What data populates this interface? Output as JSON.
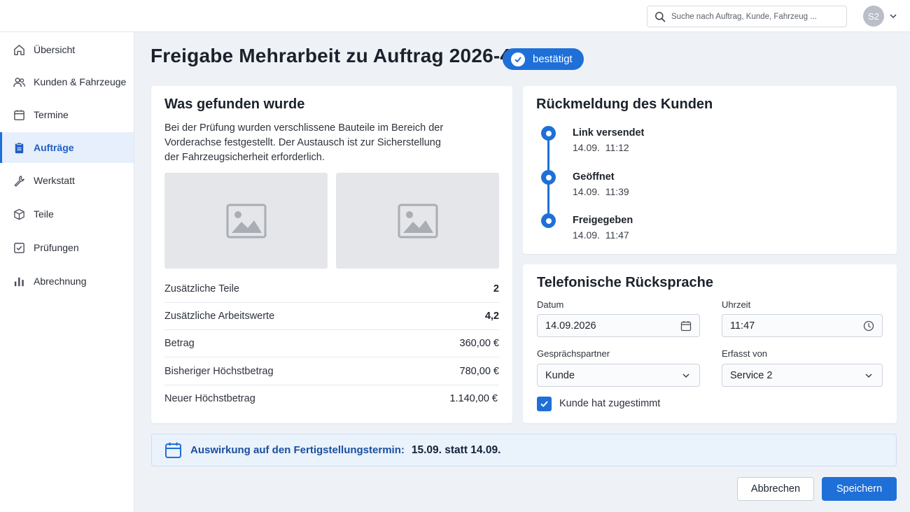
{
  "header": {
    "search_placeholder": "Suche nach Auftrag, Kunde, Fahrzeug ...",
    "user_initials": "S2"
  },
  "sidebar": {
    "items": [
      {
        "label": "Übersicht",
        "icon": "home-icon"
      },
      {
        "label": "Kunden & Fahrzeuge",
        "icon": "users-icon"
      },
      {
        "label": "Termine",
        "icon": "calendar-icon"
      },
      {
        "label": "Aufträge",
        "icon": "clipboard-icon",
        "active": true
      },
      {
        "label": "Werkstatt",
        "icon": "wrench-icon"
      },
      {
        "label": "Teile",
        "icon": "box-icon"
      },
      {
        "label": "Prüfungen",
        "icon": "checkbox-icon"
      },
      {
        "label": "Abrechnung",
        "icon": "bar-chart-icon"
      }
    ]
  },
  "page": {
    "title": "Freigabe Mehrarbeit zu Auftrag 2026-4471",
    "status": "bestätigt"
  },
  "found": {
    "title": "Was gefunden wurde",
    "description": "Bei der Prüfung wurden verschlissene Bauteile im Bereich der Vorderachse festgestellt. Der Austausch ist zur Sicherstellung der Fahrzeugsicherheit erforderlich.",
    "rows": [
      {
        "label": "Zusätzliche Teile",
        "value": "2"
      },
      {
        "label": "Zusätzliche Arbeitswerte",
        "value": "4,2"
      },
      {
        "label": "Betrag",
        "value": "360,00 €"
      },
      {
        "label": "Bisheriger Höchstbetrag",
        "value": "780,00 €"
      },
      {
        "label": "Neuer Höchstbetrag",
        "value": "1.140,00 €"
      }
    ]
  },
  "response": {
    "title": "Rückmeldung des Kunden",
    "events": [
      {
        "title": "Link versendet",
        "date": "14.09.",
        "time": "11:12"
      },
      {
        "title": "Geöffnet",
        "date": "14.09.",
        "time": "11:39"
      },
      {
        "title": "Freigegeben",
        "date": "14.09.",
        "time": "11:47"
      }
    ]
  },
  "phone": {
    "title": "Telefonische Rücksprache",
    "date_label": "Datum",
    "date_value": "14.09.2026",
    "time_label": "Uhrzeit",
    "time_value": "11:47",
    "partner_label": "Gesprächspartner",
    "partner_value": "Kunde",
    "recorded_label": "Erfasst von",
    "recorded_value": "Service 2",
    "consent_label": "Kunde hat zugestimmt",
    "consent_checked": true
  },
  "impact": {
    "label": "Auswirkung auf den Fertigstellungstermin:",
    "value": "15.09. statt 14.09."
  },
  "actions": {
    "cancel": "Abbrechen",
    "save": "Speichern"
  },
  "colors": {
    "accent": "#1f6fd8",
    "background": "#eef2f7"
  }
}
